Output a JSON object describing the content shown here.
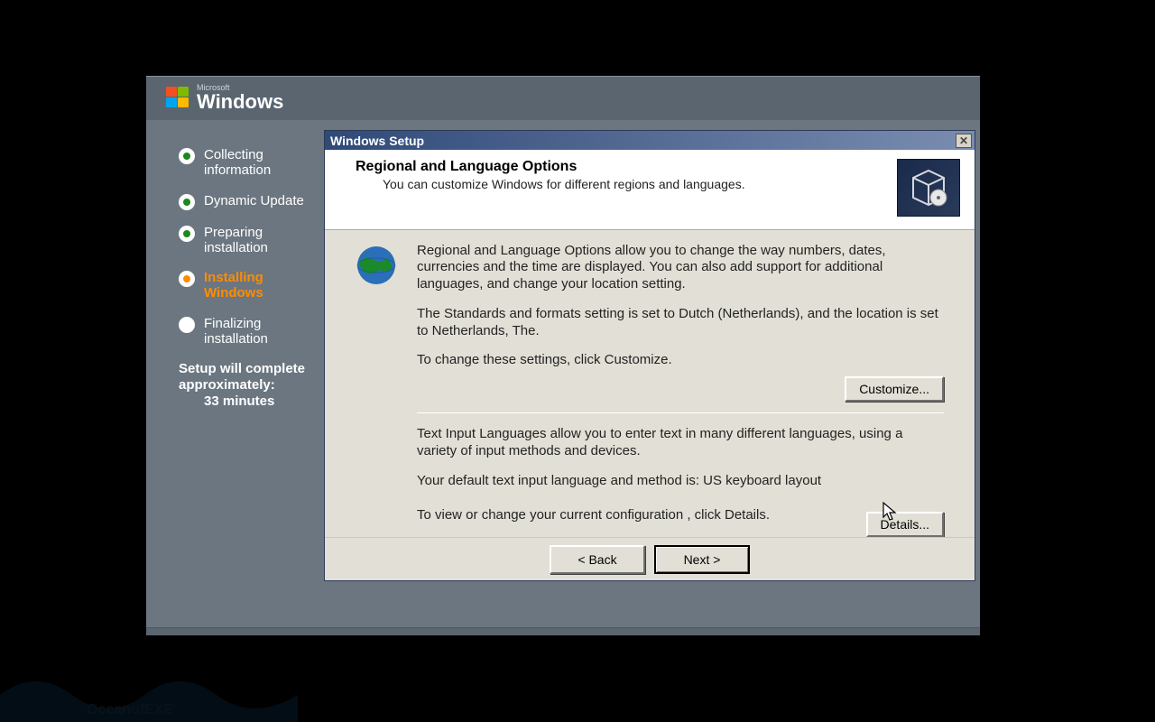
{
  "header": {
    "brand_small": "Microsoft",
    "brand_big": "Windows"
  },
  "sidebar": {
    "steps": [
      {
        "label": "Collecting information",
        "state": "done"
      },
      {
        "label": "Dynamic Update",
        "state": "done"
      },
      {
        "label": "Preparing installation",
        "state": "done"
      },
      {
        "label": "Installing Windows",
        "state": "current"
      },
      {
        "label": "Finalizing installation",
        "state": "pending"
      }
    ],
    "complete_line1": "Setup will complete",
    "complete_line2": "approximately:",
    "complete_mins": "33 minutes"
  },
  "dialog": {
    "title": "Windows Setup",
    "heading": "Regional and Language Options",
    "subheading": "You can customize Windows for different regions and languages.",
    "para1": "Regional and Language Options allow you to change the way numbers, dates, currencies and the time are displayed. You can also add support for additional languages, and change your location setting.",
    "para2": "The Standards and formats setting is set to Dutch (Netherlands), and the location is set to Netherlands, The.",
    "para3": "To change these settings, click Customize.",
    "customize_label": "Customize...",
    "para4": "Text Input Languages allow you to enter text in many different languages, using a variety of input methods and devices.",
    "para5": "Your default text input language and method is: US keyboard layout",
    "para6": "To view or change your current configuration , click Details.",
    "details_label": "Details...",
    "back_label": "< Back",
    "next_label": "Next >"
  },
  "watermark": "OceanofEXE"
}
